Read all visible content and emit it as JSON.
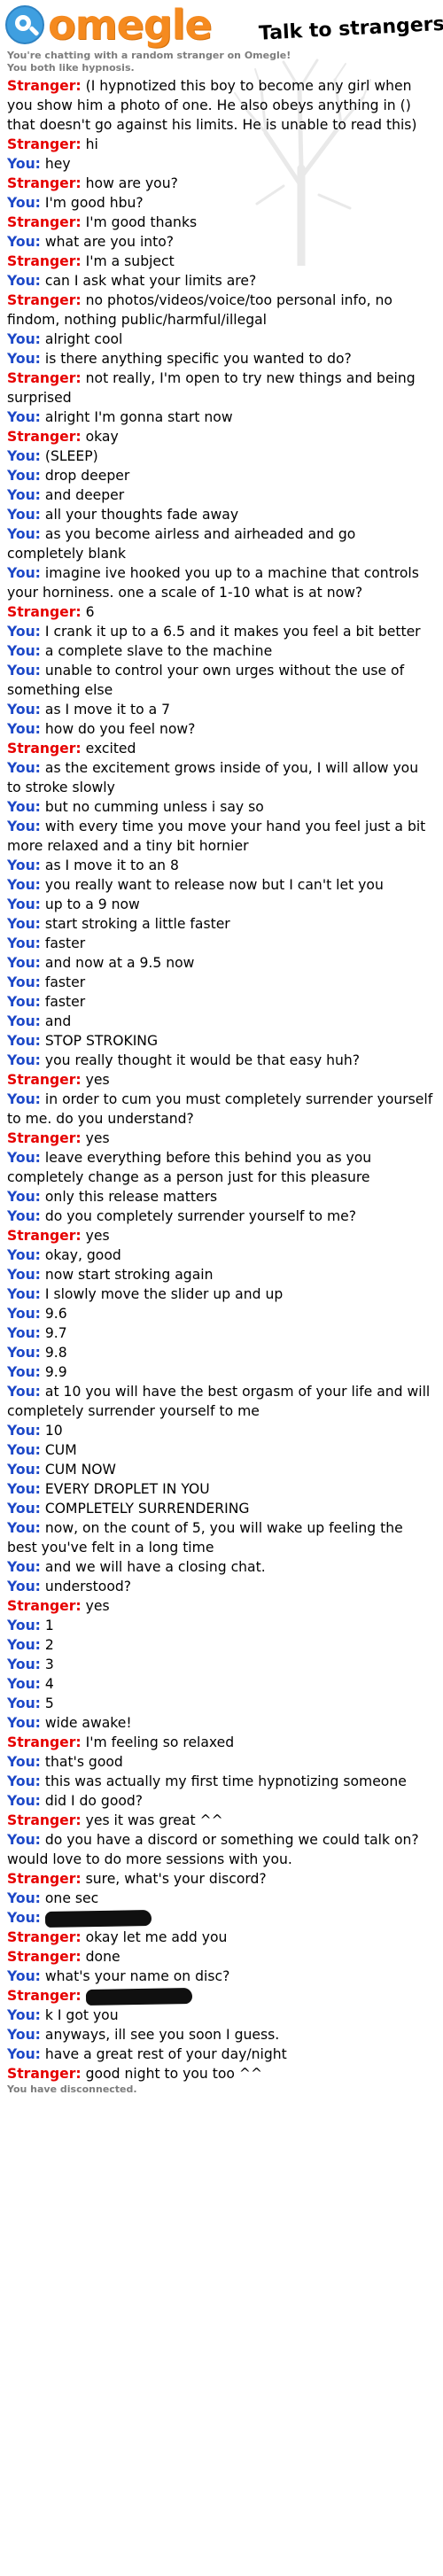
{
  "header": {
    "logo_text": "omegle",
    "tagline": "Talk to strangers!"
  },
  "meta": {
    "line1": "You're chatting with a random stranger on Omegle!",
    "line2": "You both like hypnosis."
  },
  "messages": [
    {
      "from": "Stranger:",
      "cls": "stranger",
      "text": "(I hypnotized this boy to become any girl when you show him a photo of one. He also obeys anything in () that doesn't go against his limits. He is unable to read this)"
    },
    {
      "from": "Stranger:",
      "cls": "stranger",
      "text": "hi"
    },
    {
      "from": "You:",
      "cls": "you",
      "text": "hey"
    },
    {
      "from": "Stranger:",
      "cls": "stranger",
      "text": "how are you?"
    },
    {
      "from": "You:",
      "cls": "you",
      "text": "I'm good hbu?"
    },
    {
      "from": "Stranger:",
      "cls": "stranger",
      "text": "I'm good thanks"
    },
    {
      "from": "You:",
      "cls": "you",
      "text": "what are you into?"
    },
    {
      "from": "Stranger:",
      "cls": "stranger",
      "text": "I'm a subject"
    },
    {
      "from": "You:",
      "cls": "you",
      "text": "can I ask what your limits are?"
    },
    {
      "from": "Stranger:",
      "cls": "stranger",
      "text": "no photos/videos/voice/too personal info, no findom, nothing public/harmful/illegal"
    },
    {
      "from": "You:",
      "cls": "you",
      "text": "alright cool"
    },
    {
      "from": "You:",
      "cls": "you",
      "text": "is there anything specific you wanted to do?"
    },
    {
      "from": "Stranger:",
      "cls": "stranger",
      "text": "not really, I'm open to try new things and being surprised"
    },
    {
      "from": "You:",
      "cls": "you",
      "text": "alright I'm gonna start now"
    },
    {
      "from": "Stranger:",
      "cls": "stranger",
      "text": "okay"
    },
    {
      "from": "You:",
      "cls": "you",
      "text": "(SLEEP)"
    },
    {
      "from": "You:",
      "cls": "you",
      "text": "drop deeper"
    },
    {
      "from": "You:",
      "cls": "you",
      "text": "and deeper"
    },
    {
      "from": "You:",
      "cls": "you",
      "text": "all your thoughts fade away"
    },
    {
      "from": "You:",
      "cls": "you",
      "text": "as you become airless and airheaded and go completely blank"
    },
    {
      "from": "You:",
      "cls": "you",
      "text": "imagine ive hooked you up to a machine that controls your horniness. one a scale of 1-10 what is at now?"
    },
    {
      "from": "Stranger:",
      "cls": "stranger",
      "text": "6"
    },
    {
      "from": "You:",
      "cls": "you",
      "text": "I crank it up to a 6.5 and it makes you feel a bit better"
    },
    {
      "from": "You:",
      "cls": "you",
      "text": "a complete slave to the machine"
    },
    {
      "from": "You:",
      "cls": "you",
      "text": "unable to control your own urges without the use of something else"
    },
    {
      "from": "You:",
      "cls": "you",
      "text": "as I move it to a 7"
    },
    {
      "from": "You:",
      "cls": "you",
      "text": "how do you feel now?"
    },
    {
      "from": "Stranger:",
      "cls": "stranger",
      "text": "excited"
    },
    {
      "from": "You:",
      "cls": "you",
      "text": "as the excitement grows inside of you, I will allow you to stroke slowly"
    },
    {
      "from": "You:",
      "cls": "you",
      "text": "but no cumming unless i say so"
    },
    {
      "from": "You:",
      "cls": "you",
      "text": "with every time you move your hand you feel just a bit more relaxed and a tiny bit hornier"
    },
    {
      "from": "You:",
      "cls": "you",
      "text": "as I move it to an 8"
    },
    {
      "from": "You:",
      "cls": "you",
      "text": "you really want to release now but I can't let you"
    },
    {
      "from": "You:",
      "cls": "you",
      "text": "up to a 9 now"
    },
    {
      "from": "You:",
      "cls": "you",
      "text": "start stroking a little faster"
    },
    {
      "from": "You:",
      "cls": "you",
      "text": "faster"
    },
    {
      "from": "You:",
      "cls": "you",
      "text": "and now at a 9.5 now"
    },
    {
      "from": "You:",
      "cls": "you",
      "text": "faster"
    },
    {
      "from": "You:",
      "cls": "you",
      "text": "faster"
    },
    {
      "from": "You:",
      "cls": "you",
      "text": "and"
    },
    {
      "from": "You:",
      "cls": "you",
      "text": "STOP STROKING"
    },
    {
      "from": "You:",
      "cls": "you",
      "text": "you really thought it would be that easy huh?"
    },
    {
      "from": "Stranger:",
      "cls": "stranger",
      "text": "yes"
    },
    {
      "from": "You:",
      "cls": "you",
      "text": "in order to cum you must completely surrender yourself to me. do you understand?"
    },
    {
      "from": "Stranger:",
      "cls": "stranger",
      "text": "yes"
    },
    {
      "from": "You:",
      "cls": "you",
      "text": "leave everything before this behind you as you completely change as a person just for this pleasure"
    },
    {
      "from": "You:",
      "cls": "you",
      "text": "only this release matters"
    },
    {
      "from": "You:",
      "cls": "you",
      "text": "do you completely surrender yourself to me?"
    },
    {
      "from": "Stranger:",
      "cls": "stranger",
      "text": "yes"
    },
    {
      "from": "You:",
      "cls": "you",
      "text": "okay, good"
    },
    {
      "from": "You:",
      "cls": "you",
      "text": "now start stroking again"
    },
    {
      "from": "You:",
      "cls": "you",
      "text": "I slowly move the slider up and up"
    },
    {
      "from": "You:",
      "cls": "you",
      "text": "9.6"
    },
    {
      "from": "You:",
      "cls": "you",
      "text": "9.7"
    },
    {
      "from": "You:",
      "cls": "you",
      "text": "9.8"
    },
    {
      "from": "You:",
      "cls": "you",
      "text": "9.9"
    },
    {
      "from": "You:",
      "cls": "you",
      "text": "at 10 you will have the best orgasm of your life and will completely surrender yourself to me"
    },
    {
      "from": "You:",
      "cls": "you",
      "text": "10"
    },
    {
      "from": "You:",
      "cls": "you",
      "text": "CUM"
    },
    {
      "from": "You:",
      "cls": "you",
      "text": "CUM NOW"
    },
    {
      "from": "You:",
      "cls": "you",
      "text": "EVERY DROPLET IN YOU"
    },
    {
      "from": "You:",
      "cls": "you",
      "text": "COMPLETELY SURRENDERING"
    },
    {
      "from": "You:",
      "cls": "you",
      "text": "now, on the count of 5, you will wake up feeling the best you've felt in a long time"
    },
    {
      "from": "You:",
      "cls": "you",
      "text": "and we will have a closing chat."
    },
    {
      "from": "You:",
      "cls": "you",
      "text": "understood?"
    },
    {
      "from": "Stranger:",
      "cls": "stranger",
      "text": "yes"
    },
    {
      "from": "You:",
      "cls": "you",
      "text": "1"
    },
    {
      "from": "You:",
      "cls": "you",
      "text": "2"
    },
    {
      "from": "You:",
      "cls": "you",
      "text": "3"
    },
    {
      "from": "You:",
      "cls": "you",
      "text": "4"
    },
    {
      "from": "You:",
      "cls": "you",
      "text": "5"
    },
    {
      "from": "You:",
      "cls": "you",
      "text": "wide awake!"
    },
    {
      "from": "Stranger:",
      "cls": "stranger",
      "text": "I'm feeling so relaxed"
    },
    {
      "from": "You:",
      "cls": "you",
      "text": "that's good"
    },
    {
      "from": "You:",
      "cls": "you",
      "text": "this was actually my first time hypnotizing someone"
    },
    {
      "from": "You:",
      "cls": "you",
      "text": "did I do good?"
    },
    {
      "from": "Stranger:",
      "cls": "stranger",
      "text": "yes it was great ^^"
    },
    {
      "from": "You:",
      "cls": "you",
      "text": "do you have a discord or something we could talk on? would love to do more sessions with you."
    },
    {
      "from": "Stranger:",
      "cls": "stranger",
      "text": "sure, what's your discord?"
    },
    {
      "from": "You:",
      "cls": "you",
      "text": "one sec"
    },
    {
      "from": "You:",
      "cls": "you",
      "text": "",
      "redacted": true
    },
    {
      "from": "Stranger:",
      "cls": "stranger",
      "text": "okay let me add you"
    },
    {
      "from": "Stranger:",
      "cls": "stranger",
      "text": "done"
    },
    {
      "from": "You:",
      "cls": "you",
      "text": "what's your name on disc?"
    },
    {
      "from": "Stranger:",
      "cls": "stranger",
      "text": "",
      "redacted": true
    },
    {
      "from": "You:",
      "cls": "you",
      "text": "k I got you"
    },
    {
      "from": "You:",
      "cls": "you",
      "text": "anyways, ill see you soon I guess."
    },
    {
      "from": "You:",
      "cls": "you",
      "text": "have a great rest of your day/night"
    },
    {
      "from": "Stranger:",
      "cls": "stranger",
      "text": "good night to you too ^^"
    }
  ],
  "status": "You have disconnected."
}
